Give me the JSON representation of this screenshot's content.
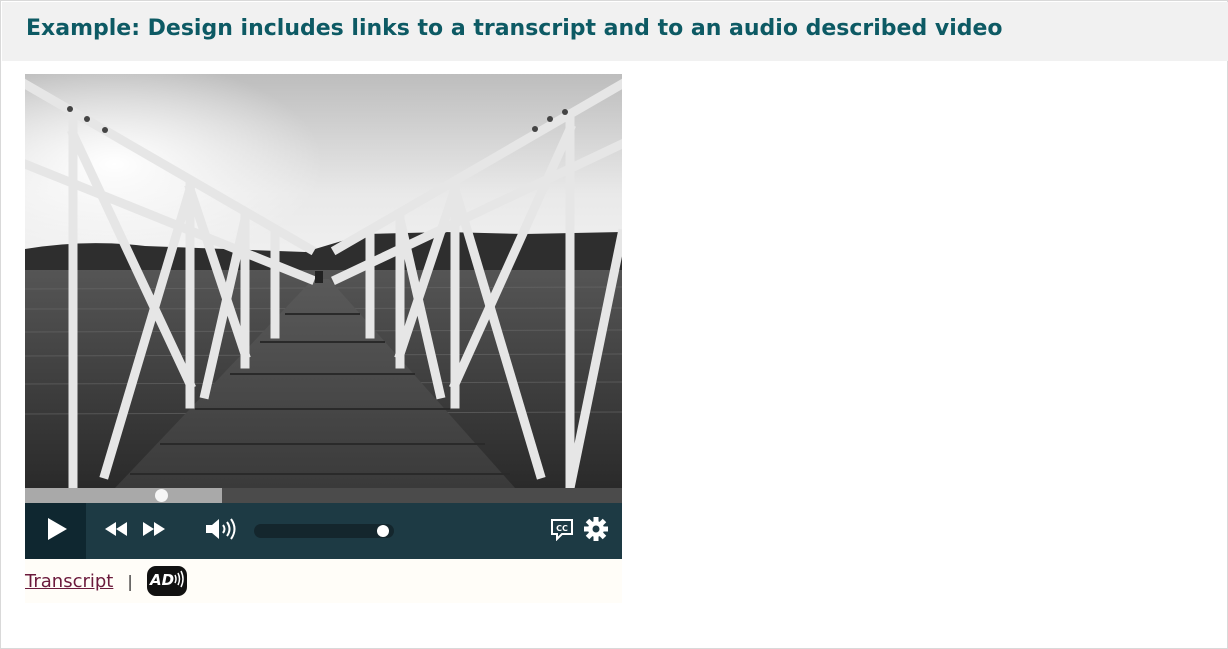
{
  "example": {
    "title": "Example: Design includes links to a transcript and to an audio described video"
  },
  "video": {
    "description_icon": "photo-of-pier-bridge",
    "progress_fraction": 0.33,
    "volume_fraction": 0.95
  },
  "controls": {
    "play_icon": "play-icon",
    "rewind_icon": "rewind-icon",
    "fast_forward_icon": "fast-forward-icon",
    "volume_icon": "volume-icon",
    "captions_icon": "closed-captions-icon",
    "settings_icon": "gear-icon",
    "cc_label": "CC"
  },
  "links": {
    "transcript": "Transcript",
    "separator": "|",
    "audio_description_label": "AD"
  },
  "colors": {
    "title": "#0d5a64",
    "header_bg": "#f1f1f1",
    "controls_bg": "#1d3a44",
    "link": "#6b1a3c"
  }
}
